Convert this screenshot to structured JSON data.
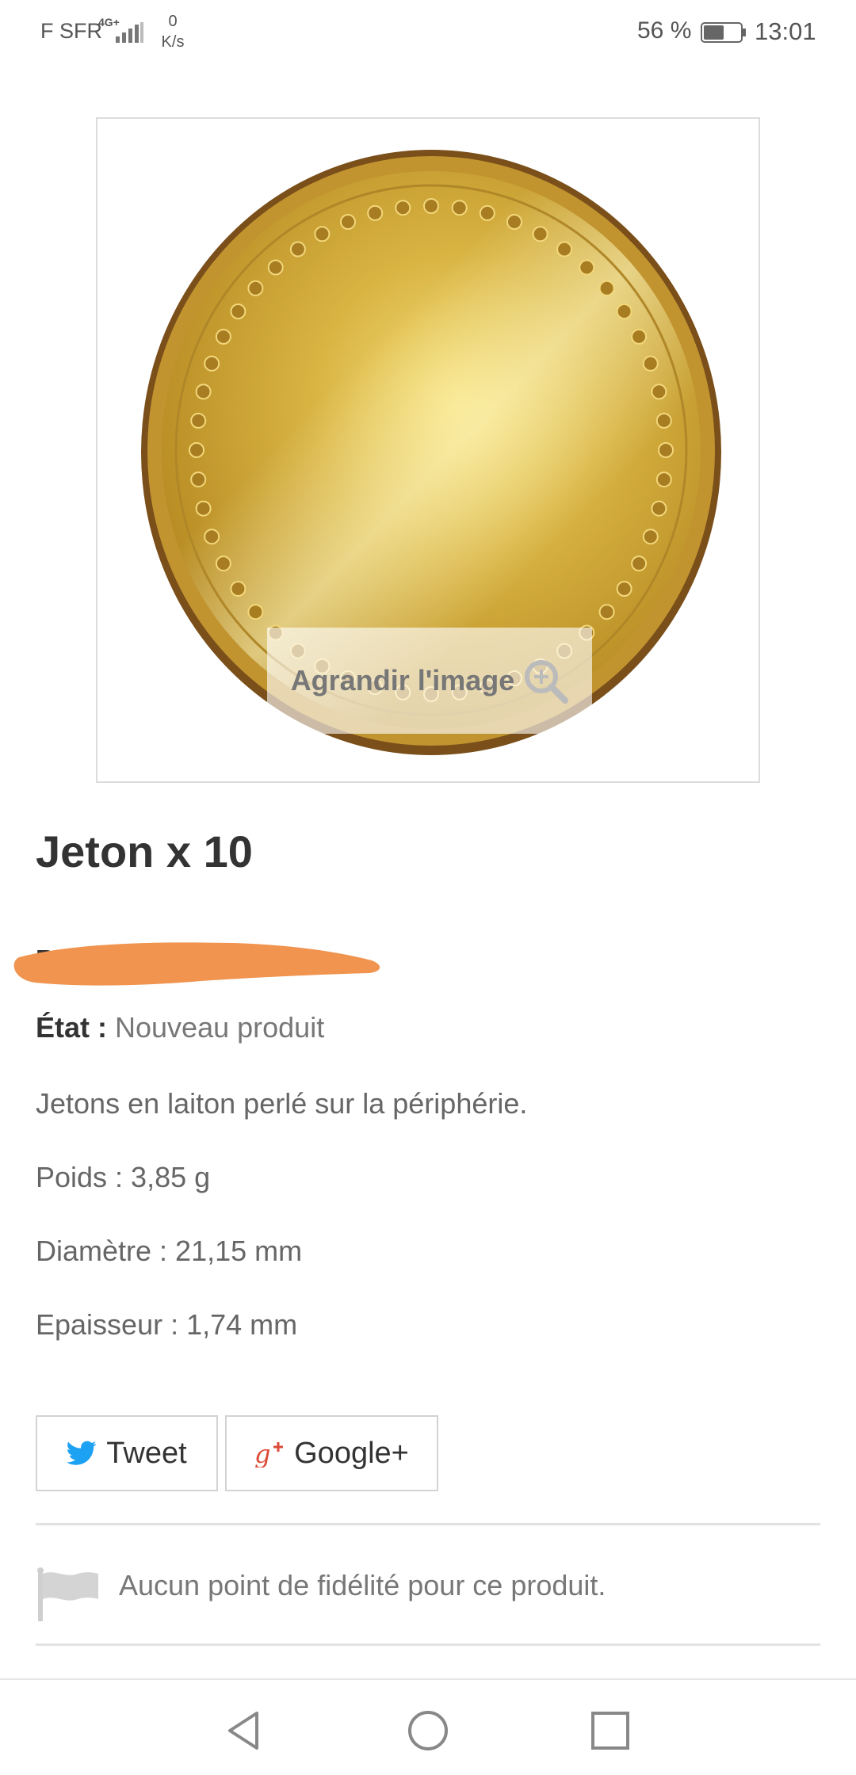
{
  "status_bar": {
    "carrier": "F SFR",
    "network_type": "4G+",
    "speed_value": "0",
    "speed_unit": "K/s",
    "battery_percent": "56 %",
    "battery_level": 0.56,
    "time": "13:01",
    "icons": [
      "signal-icon",
      "battery-icon"
    ]
  },
  "product_image": {
    "zoom_label": "Agrandir l'image",
    "zoom_icon": "magnifier-icon"
  },
  "product": {
    "title": "Jeton x 10",
    "reference_partial": "Re",
    "condition_label": "État :",
    "condition_value": "Nouveau produit",
    "description": [
      "Jetons en laiton perlé sur la périphérie.",
      "Poids : 3,85 g",
      "Diamètre : 21,15 mm",
      "Epaisseur : 1,74 mm"
    ]
  },
  "share": {
    "tweet_label": "Tweet",
    "gplus_label": "Google+"
  },
  "loyalty": {
    "text": "Aucun point de fidélité pour ce produit.",
    "icon": "flag-icon"
  },
  "nav_bar": {
    "icons": [
      "back-icon",
      "home-icon",
      "recent-apps-icon"
    ]
  },
  "colors": {
    "twitter": "#1da1f2",
    "google_plus": "#dd4b39",
    "redaction": "#f0944f",
    "coin_gold": "#d6b040"
  }
}
